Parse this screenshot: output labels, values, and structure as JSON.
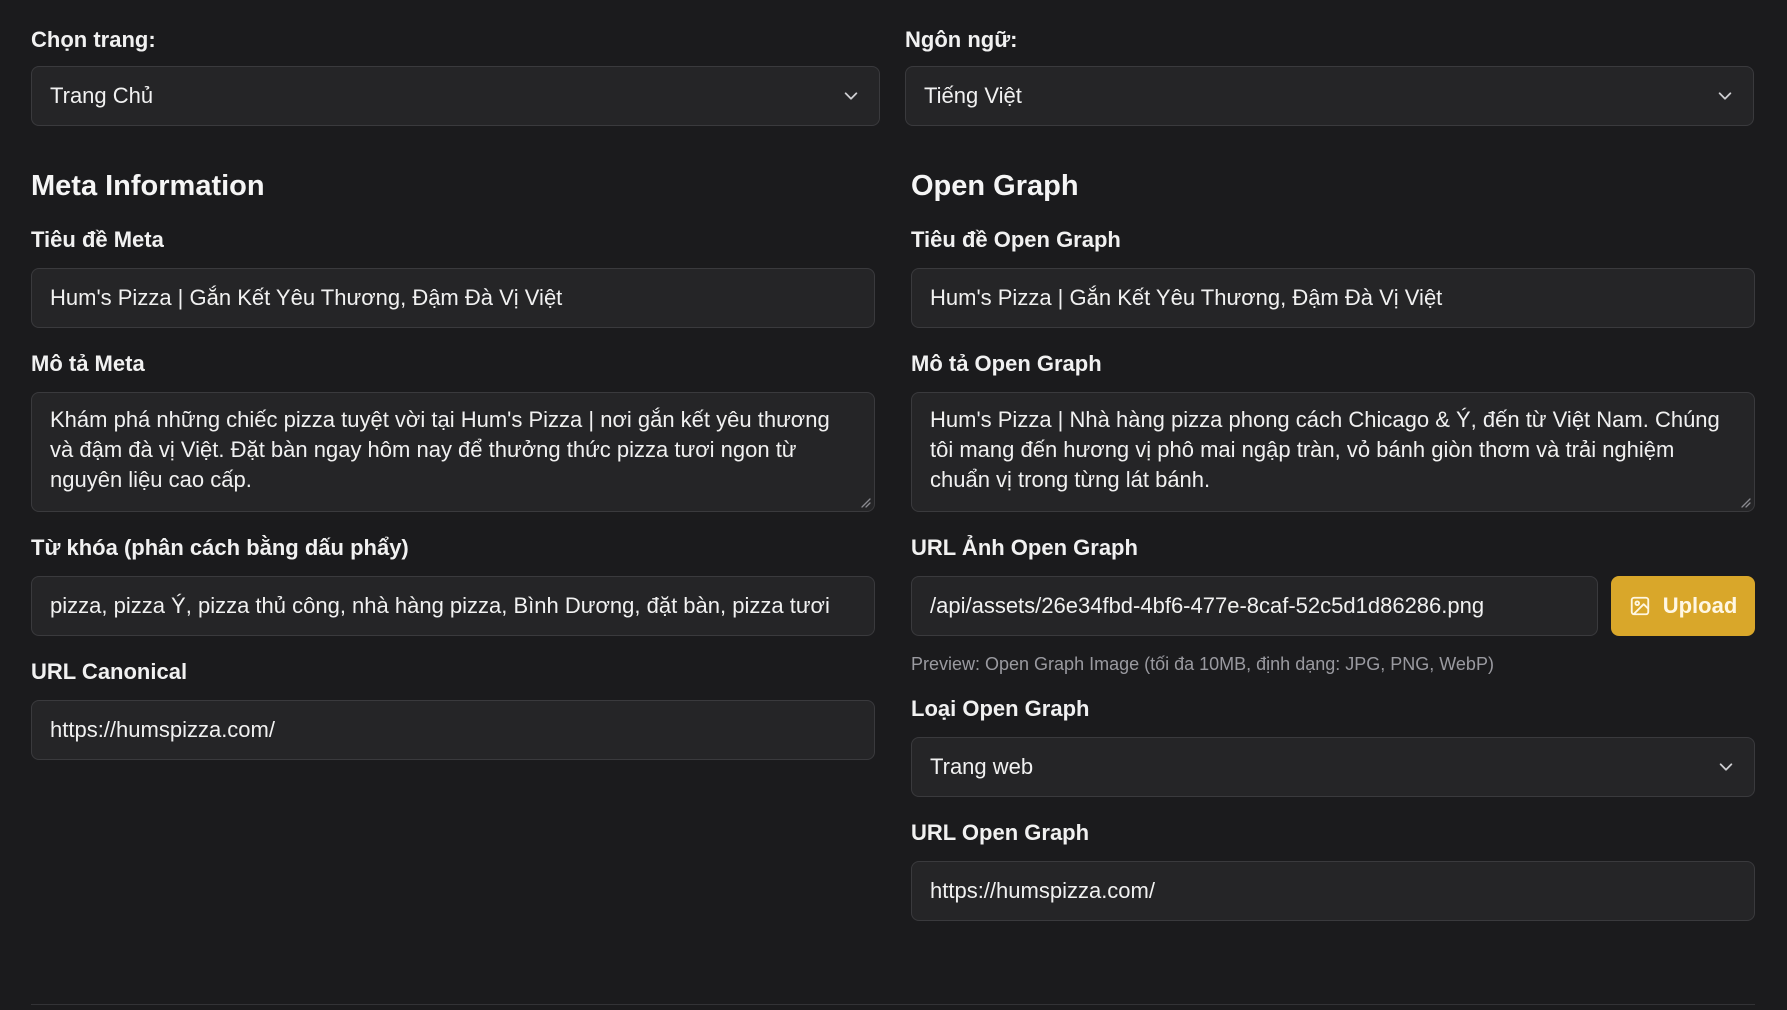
{
  "page_select": {
    "label": "Chọn trang:",
    "value": "Trang Chủ"
  },
  "language_select": {
    "label": "Ngôn ngữ:",
    "value": "Tiếng Việt"
  },
  "meta": {
    "section_title": "Meta Information",
    "title_label": "Tiêu đề Meta",
    "title_value": "Hum's Pizza | Gắn Kết Yêu Thương, Đậm Đà Vị Việt",
    "description_label": "Mô tả Meta",
    "description_value": "Khám phá những chiếc pizza tuyệt vời tại Hum's Pizza | nơi gắn kết yêu thương và đậm đà vị Việt. Đặt bàn ngay hôm nay để thưởng thức pizza tươi ngon từ nguyên liệu cao cấp.",
    "keywords_label": "Từ khóa (phân cách bằng dấu phẩy)",
    "keywords_value": "pizza, pizza Ý, pizza thủ công, nhà hàng pizza, Bình Dương, đặt bàn, pizza tươi",
    "canonical_label": "URL Canonical",
    "canonical_value": "https://humspizza.com/"
  },
  "open_graph": {
    "section_title": "Open Graph",
    "title_label": "Tiêu đề Open Graph",
    "title_value": "Hum's Pizza | Gắn Kết Yêu Thương, Đậm Đà Vị Việt",
    "description_label": "Mô tả Open Graph",
    "description_value": "Hum's Pizza | Nhà hàng pizza phong cách Chicago & Ý, đến từ Việt Nam. Chúng tôi mang đến hương vị phô mai ngập tràn, vỏ bánh giòn thơm và trải nghiệm chuẩn vị trong từng lát bánh.",
    "image_url_label": "URL Ảnh Open Graph",
    "image_url_value": "/api/assets/26e34fbd-4bf6-477e-8caf-52c5d1d86286.png",
    "upload_label": "Upload",
    "image_hint": "Preview: Open Graph Image (tối đa 10MB, định dạng: JPG, PNG, WebP)",
    "type_label": "Loại Open Graph",
    "type_value": "Trang web",
    "url_label": "URL Open Graph",
    "url_value": "https://humspizza.com/"
  },
  "colors": {
    "background": "#1b1b1d",
    "field_background": "#252527",
    "field_border": "#3a3a3d",
    "accent": "#d9a72a",
    "hint_text": "#9a9aa0"
  },
  "icons": {
    "select_chevron": "chevron-down-icon",
    "upload": "image-icon",
    "resize": "resize-handle-icon"
  }
}
